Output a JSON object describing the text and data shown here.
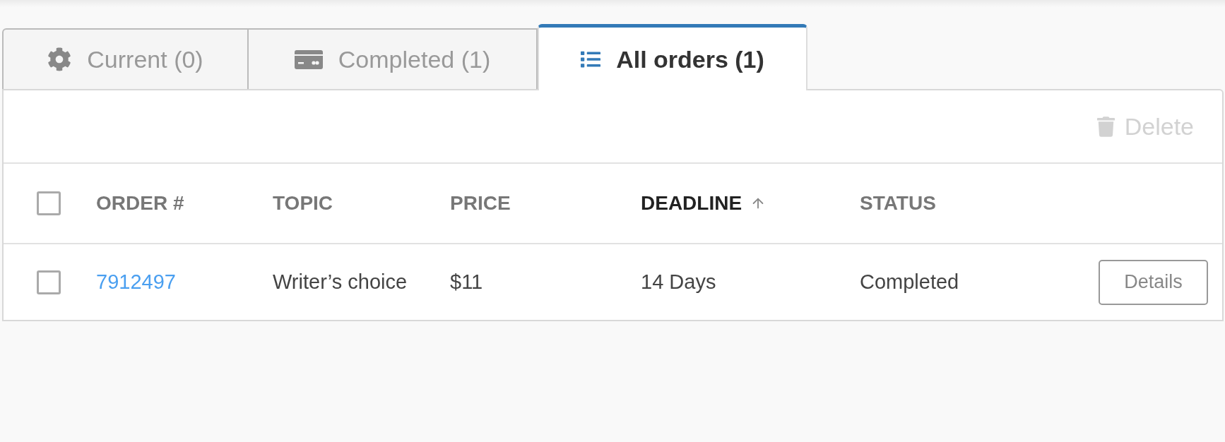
{
  "tabs": [
    {
      "label": "Current (0)",
      "selected": false
    },
    {
      "label": "Completed (1)",
      "selected": false
    },
    {
      "label": "All orders (1)",
      "selected": true
    }
  ],
  "toolbar": {
    "delete_button": {
      "label": "Delete",
      "disabled": true
    }
  },
  "table": {
    "select_all": {
      "checked": false
    },
    "columns": [
      {
        "label": "ORDER #",
        "sorted": false
      },
      {
        "label": "TOPIC",
        "sorted": false
      },
      {
        "label": "PRICE",
        "sorted": false
      },
      {
        "label": "DEADLINE",
        "sorted": true
      },
      {
        "label": "STATUS",
        "sorted": false
      }
    ],
    "rows": [
      {
        "checked": false,
        "order_number": "7912497",
        "topic": "Writer’s choice",
        "price": "$11",
        "deadline": "14 Days",
        "status": "Completed",
        "details_button": "Details"
      }
    ]
  }
}
